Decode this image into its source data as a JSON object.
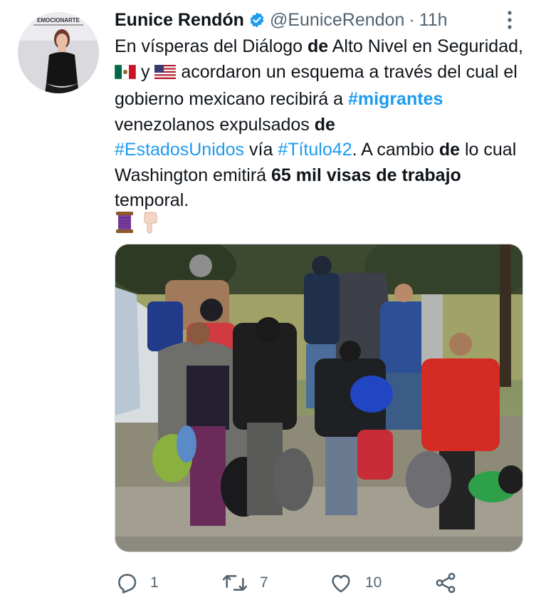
{
  "author": {
    "display_name": "Eunice Rendón",
    "handle": "@EuniceRendon",
    "separator": "·",
    "time": "11h",
    "verified": true,
    "avatar_banner_text": "EMOCIONARTE"
  },
  "tweet": {
    "p1": "En vísperas del Diálogo ",
    "b1": "de",
    "p2": " Alto Nivel en Seguridad, ",
    "p3": " y ",
    "p4": " acordaron un esquema a través del cual el gobierno mexicano recibirá a ",
    "hashtag_migrantes": "#migrantes",
    "p5": " venezolanos expulsados ",
    "b2": "de",
    "hashtag_eeuu": "#EstadosUnidos",
    "p6": " vía ",
    "hashtag_titulo": "#Título42",
    "p7": ". A cambio ",
    "b3": "de",
    "p8": " lo cual Washington emitirá ",
    "b4": "65 mil visas de trabajo",
    "p9": " temporal."
  },
  "icons": [
    "verified-badge-icon",
    "more-options-icon",
    "mexico-flag-icon",
    "usa-flag-icon",
    "thread-spool-icon",
    "pointing-down-icon",
    "reply-icon",
    "retweet-icon",
    "like-icon",
    "share-icon"
  ],
  "actions": {
    "reply_count": "1",
    "retweet_count": "7",
    "like_count": "10"
  },
  "colors": {
    "link": "#1d9bf0",
    "secondary_text": "#536471",
    "primary_text": "#0f1419"
  }
}
